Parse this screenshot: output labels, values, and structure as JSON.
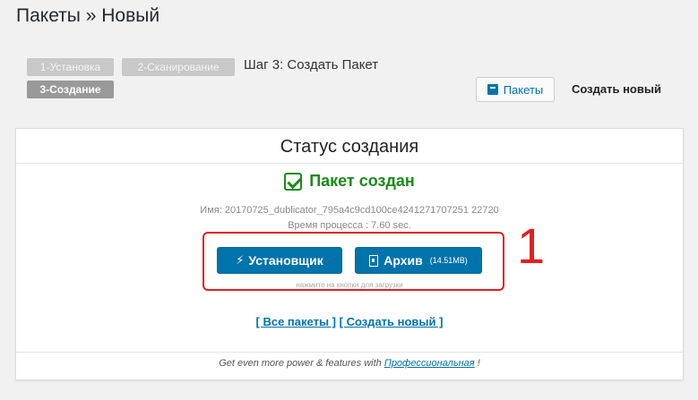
{
  "header": {
    "title": "Пакеты » Новый"
  },
  "steps": {
    "step1": "1-Установка",
    "step2": "2-Сканирование",
    "current_title": "Шаг 3: Создать Пакет",
    "step3": "3-Создание"
  },
  "toolbar": {
    "packages_label": "Пакеты",
    "create_new_label": "Создать новый"
  },
  "panel": {
    "title": "Статус создания",
    "success_text": "Пакет создан",
    "name_line": "Имя: 20170725_dublicator_795a4c9cd100ce4241271707251 22720",
    "process_time": "Время процесса : 7.60 sec.",
    "installer_label": "Установщик",
    "archive_label": "Архив",
    "archive_size": "(14.51MB)",
    "hint": "нажмите на кнопки для загрузки",
    "all_packages_link": "[ Все пакеты ]",
    "create_new_link": "[ Создать новый ]",
    "footer_text": "Get even more power & features with",
    "footer_link": "Профессиональная",
    "footer_suffix": "!"
  },
  "annotation": {
    "number": "1"
  },
  "colors": {
    "accent": "#0073aa",
    "success": "#1a8a1a",
    "annotation": "#e02020"
  }
}
